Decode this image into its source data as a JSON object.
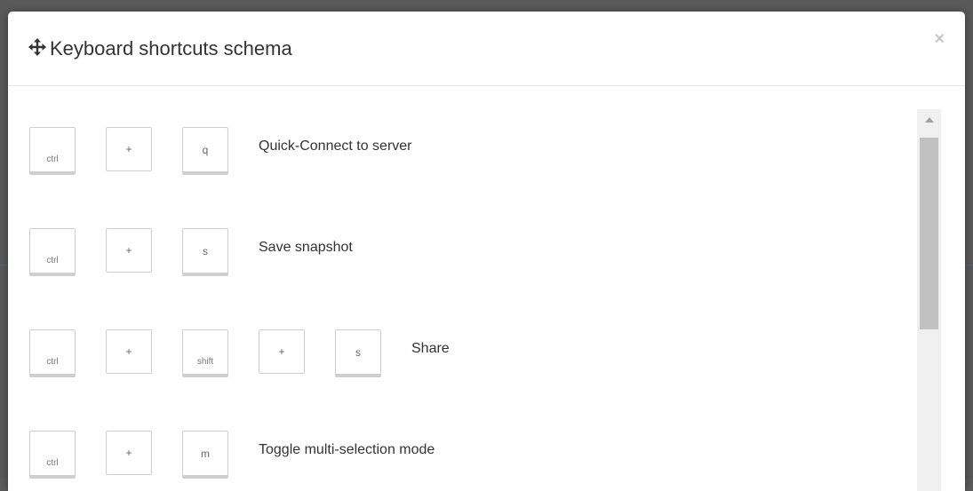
{
  "dialog": {
    "title": "Keyboard shortcuts schema",
    "close_label": "×",
    "title_icon": "move-icon"
  },
  "shortcuts": [
    {
      "keys": [
        "ctrl",
        "+",
        "q"
      ],
      "label": "Quick-Connect to server"
    },
    {
      "keys": [
        "ctrl",
        "+",
        "s"
      ],
      "label": "Save snapshot"
    },
    {
      "keys": [
        "ctrl",
        "+",
        "shift",
        "+",
        "s"
      ],
      "label": "Share"
    },
    {
      "keys": [
        "ctrl",
        "+",
        "m"
      ],
      "label": "Toggle multi-selection mode"
    }
  ],
  "scrollbar": {
    "up_icon": "triangle-up-icon",
    "position_fraction": 0.0
  },
  "colors": {
    "backdrop": "#595959",
    "modal_bg": "#ffffff",
    "key_border": "#cfcfcf",
    "text": "#333333",
    "close": "#c8c8c8",
    "scroll_track": "#f0f0f0",
    "scroll_thumb": "#c1c1c1"
  }
}
